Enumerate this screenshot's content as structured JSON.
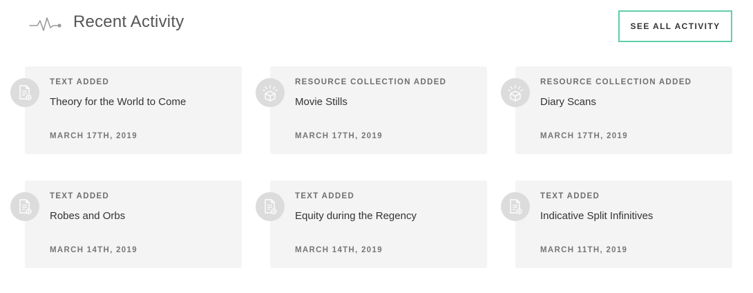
{
  "header": {
    "title": "Recent Activity",
    "see_all_label": "SEE ALL ACTIVITY",
    "accent_color": "#5fd0a8",
    "icon": "activity-pulse-icon"
  },
  "cards": [
    {
      "type": "TEXT ADDED",
      "title": "Theory for the World to Come",
      "date": "MARCH 17TH, 2019",
      "icon": "text-document-icon"
    },
    {
      "type": "RESOURCE COLLECTION ADDED",
      "title": "Movie Stills",
      "date": "MARCH 17TH, 2019",
      "icon": "resource-box-icon"
    },
    {
      "type": "RESOURCE COLLECTION ADDED",
      "title": "Diary Scans",
      "date": "MARCH 17TH, 2019",
      "icon": "resource-box-icon"
    },
    {
      "type": "TEXT ADDED",
      "title": "Robes and Orbs",
      "date": "MARCH 14TH, 2019",
      "icon": "text-document-icon"
    },
    {
      "type": "TEXT ADDED",
      "title": "Equity during the Regency",
      "date": "MARCH 14TH, 2019",
      "icon": "text-document-icon"
    },
    {
      "type": "TEXT ADDED",
      "title": "Indicative Split Infinitives",
      "date": "MARCH 11TH, 2019",
      "icon": "text-document-icon"
    }
  ]
}
